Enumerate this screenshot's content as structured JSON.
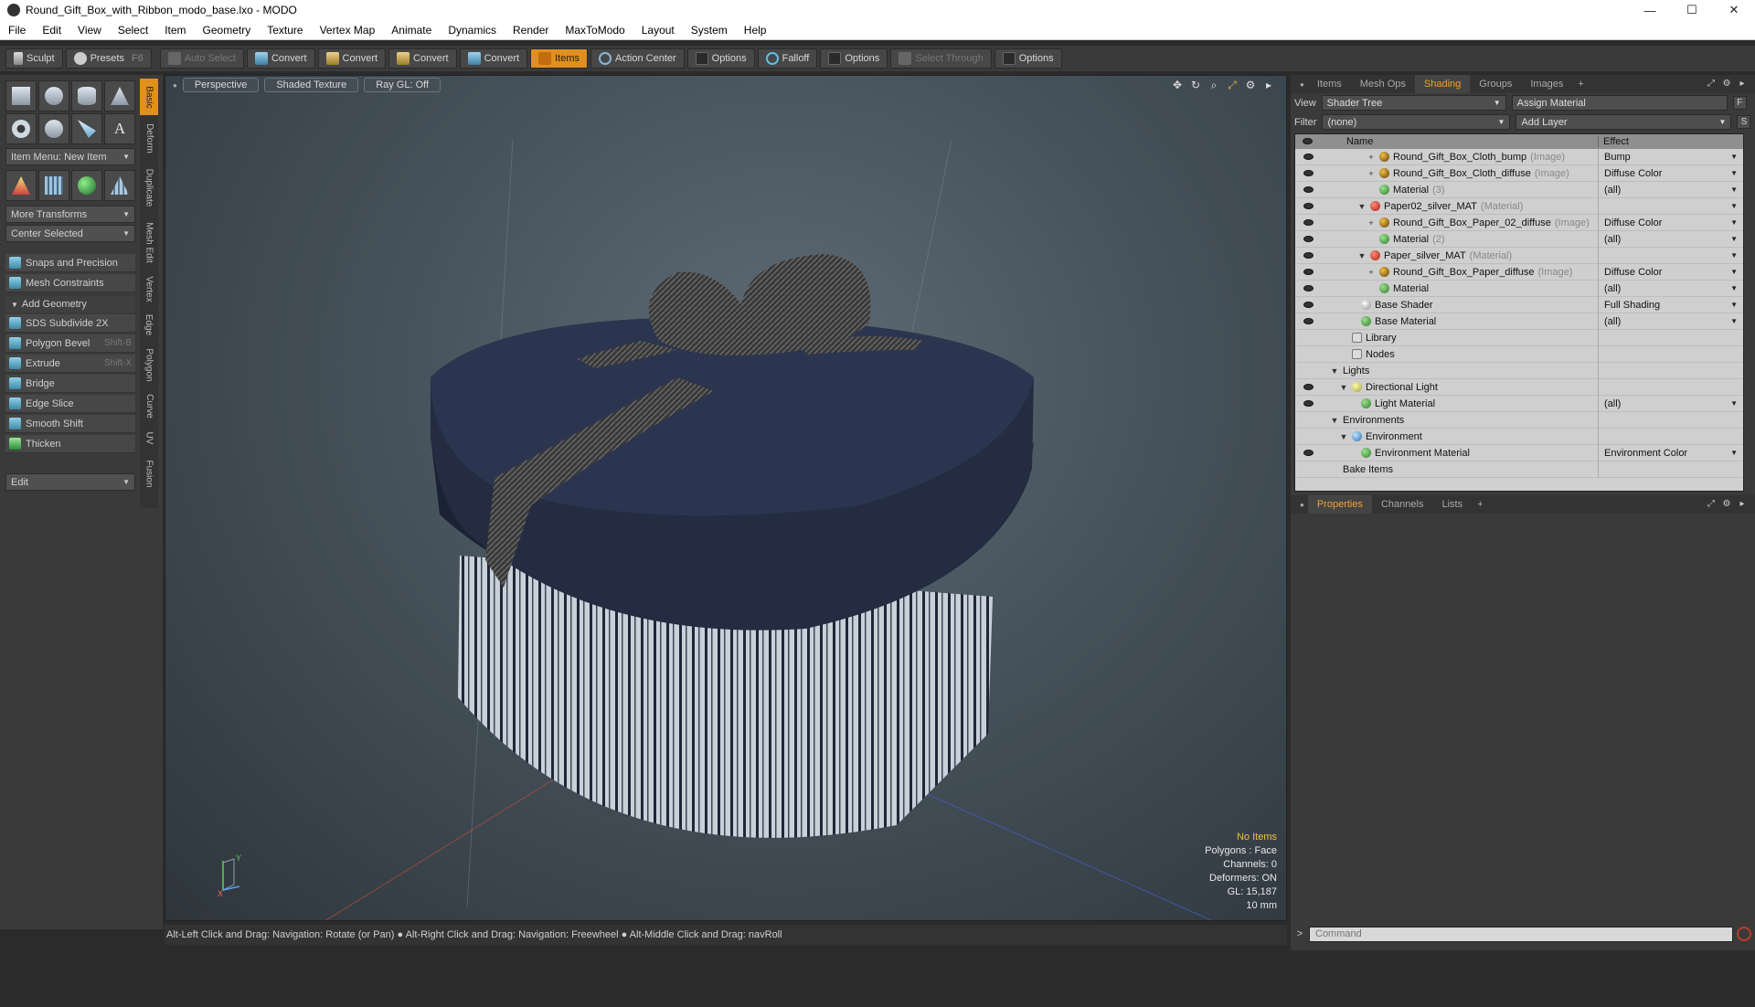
{
  "window": {
    "title": "Round_Gift_Box_with_Ribbon_modo_base.lxo - MODO",
    "controls": [
      "—",
      "☐",
      "✕"
    ]
  },
  "menu": [
    "File",
    "Edit",
    "View",
    "Select",
    "Item",
    "Geometry",
    "Texture",
    "Vertex Map",
    "Animate",
    "Dynamics",
    "Render",
    "MaxToModo",
    "Layout",
    "System",
    "Help"
  ],
  "toolbar": {
    "sculpt": "Sculpt",
    "presets": "Presets",
    "presets_key": "F6",
    "auto_select": "Auto Select",
    "convert1": "Convert",
    "convert2": "Convert",
    "convert3": "Convert",
    "convert4": "Convert",
    "items": "Items",
    "action_center": "Action Center",
    "options1": "Options",
    "falloff": "Falloff",
    "options2": "Options",
    "select_through": "Select Through",
    "options3": "Options"
  },
  "left": {
    "item_menu": "Item Menu: New Item",
    "more_transforms": "More Transforms",
    "center_selected": "Center Selected",
    "snaps": "Snaps and Precision",
    "mesh_constraints": "Mesh Constraints",
    "add_geometry": "Add Geometry",
    "tools": [
      {
        "label": "SDS Subdivide 2X",
        "key": ""
      },
      {
        "label": "Polygon Bevel",
        "key": "Shift-B"
      },
      {
        "label": "Extrude",
        "key": "Shift-X"
      },
      {
        "label": "Bridge",
        "key": ""
      },
      {
        "label": "Edge Slice",
        "key": ""
      },
      {
        "label": "Smooth Shift",
        "key": ""
      },
      {
        "label": "Thicken",
        "key": ""
      }
    ],
    "edit": "Edit",
    "vtabs": [
      "Basic",
      "Deform",
      "Duplicate",
      "Mesh Edit",
      "Vertex",
      "Edge",
      "Polygon",
      "Curve",
      "UV",
      "Fusion"
    ]
  },
  "viewport": {
    "view": "Perspective",
    "shading": "Shaded Texture",
    "raygl": "Ray GL: Off",
    "stats": {
      "items": "No Items",
      "polygons": "Polygons : Face",
      "channels": "Channels: 0",
      "deformers": "Deformers: ON",
      "gl": "GL: 15,187",
      "scale": "10 mm"
    },
    "status": "Alt-Left Click and Drag: Navigation: Rotate (or Pan) ● Alt-Right Click and Drag: Navigation: Freewheel ● Alt-Middle Click and Drag: navRoll"
  },
  "right": {
    "tabs": [
      "Items",
      "Mesh Ops",
      "Shading",
      "Groups",
      "Images"
    ],
    "view_label": "View",
    "view_value": "Shader Tree",
    "assign": "Assign Material",
    "filter_label": "Filter",
    "filter_value": "(none)",
    "add_layer": "Add Layer",
    "col_name": "Name",
    "col_effect": "Effect",
    "rows": [
      {
        "indent": 5,
        "exp": "+",
        "icon": "img",
        "name": "Round_Gift_Box_Cloth_bump",
        "type": "(Image)",
        "effect": "Bump",
        "eye": true,
        "dd": true
      },
      {
        "indent": 5,
        "exp": "+",
        "icon": "img",
        "name": "Round_Gift_Box_Cloth_diffuse",
        "type": "(Image)",
        "effect": "Diffuse Color",
        "eye": true,
        "dd": true
      },
      {
        "indent": 5,
        "exp": "",
        "icon": "mat",
        "name": "Material",
        "type": "(3)",
        "effect": "(all)",
        "eye": true,
        "dd": true
      },
      {
        "indent": 4,
        "exp": "▼",
        "icon": "matred",
        "name": "Paper02_silver_MAT",
        "type": "(Material)",
        "effect": "",
        "eye": true,
        "dd": true
      },
      {
        "indent": 5,
        "exp": "+",
        "icon": "img",
        "name": "Round_Gift_Box_Paper_02_diffuse",
        "type": "(Image)",
        "effect": "Diffuse Color",
        "eye": true,
        "dd": true
      },
      {
        "indent": 5,
        "exp": "",
        "icon": "mat",
        "name": "Material",
        "type": "(2)",
        "effect": "(all)",
        "eye": true,
        "dd": true
      },
      {
        "indent": 4,
        "exp": "▼",
        "icon": "matred",
        "name": "Paper_silver_MAT",
        "type": "(Material)",
        "effect": "",
        "eye": true,
        "dd": true
      },
      {
        "indent": 5,
        "exp": "+",
        "icon": "img",
        "name": "Round_Gift_Box_Paper_diffuse",
        "type": "(Image)",
        "effect": "Diffuse Color",
        "eye": true,
        "dd": true
      },
      {
        "indent": 5,
        "exp": "",
        "icon": "mat",
        "name": "Material",
        "type": "",
        "effect": "(all)",
        "eye": true,
        "dd": true
      },
      {
        "indent": 3,
        "exp": "",
        "icon": "shader",
        "name": "Base Shader",
        "type": "",
        "effect": "Full Shading",
        "eye": true,
        "dd": true
      },
      {
        "indent": 3,
        "exp": "",
        "icon": "mat",
        "name": "Base Material",
        "type": "",
        "effect": "(all)",
        "eye": true,
        "dd": true
      },
      {
        "indent": 2,
        "exp": "",
        "icon": "folder",
        "name": "Library",
        "type": "",
        "effect": "",
        "eye": false,
        "dd": false
      },
      {
        "indent": 2,
        "exp": "",
        "icon": "folder",
        "name": "Nodes",
        "type": "",
        "effect": "",
        "eye": false,
        "dd": false
      },
      {
        "indent": 1,
        "exp": "▼",
        "icon": "",
        "name": "Lights",
        "type": "",
        "effect": "",
        "eye": false,
        "dd": false
      },
      {
        "indent": 2,
        "exp": "▼",
        "icon": "light",
        "name": "Directional Light",
        "type": "",
        "effect": "",
        "eye": true,
        "dd": false
      },
      {
        "indent": 3,
        "exp": "",
        "icon": "mat",
        "name": "Light Material",
        "type": "",
        "effect": "(all)",
        "eye": true,
        "dd": true
      },
      {
        "indent": 1,
        "exp": "▼",
        "icon": "",
        "name": "Environments",
        "type": "",
        "effect": "",
        "eye": false,
        "dd": false
      },
      {
        "indent": 2,
        "exp": "▼",
        "icon": "env",
        "name": "Environment",
        "type": "",
        "effect": "",
        "eye": false,
        "dd": false
      },
      {
        "indent": 3,
        "exp": "",
        "icon": "mat",
        "name": "Environment Material",
        "type": "",
        "effect": "Environment Color",
        "eye": true,
        "dd": true
      },
      {
        "indent": 1,
        "exp": "",
        "icon": "",
        "name": "Bake Items",
        "type": "",
        "effect": "",
        "eye": false,
        "dd": false
      }
    ],
    "props_tabs": [
      "Properties",
      "Channels",
      "Lists"
    ],
    "command_placeholder": "Command"
  }
}
